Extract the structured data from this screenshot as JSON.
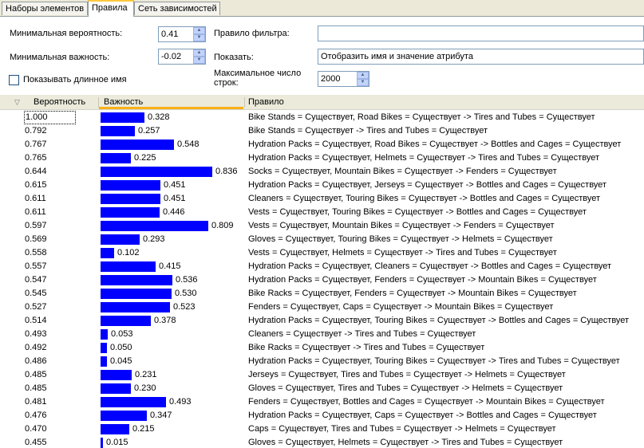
{
  "tabs": [
    {
      "label": "Наборы элементов",
      "active": false
    },
    {
      "label": "Правила",
      "active": true
    },
    {
      "label": "Сеть зависимостей",
      "active": false
    }
  ],
  "filters": {
    "min_probability_label": "Минимальная вероятность:",
    "min_probability_value": "0.41",
    "min_importance_label": "Минимальная важность:",
    "min_importance_value": "-0.02",
    "long_name_label": "Показывать длинное имя",
    "long_name_checked": false,
    "filter_rule_label": "Правило фильтра:",
    "filter_rule_value": "",
    "show_label": "Показать:",
    "show_value": "Отобразить имя и значение атрибута",
    "max_rows_label": "Максимальное число строк:",
    "max_rows_value": "2000"
  },
  "grid": {
    "columns": [
      "Вероятность",
      "Важность",
      "Правило"
    ],
    "accent_color": "#0000ff",
    "rows": [
      {
        "probability": "1.000",
        "importance": 0.328,
        "importance_label": "0.328",
        "rule": "Bike Stands = Существует, Road Bikes = Существует -> Tires and Tubes = Существует"
      },
      {
        "probability": "0.792",
        "importance": 0.257,
        "importance_label": "0.257",
        "rule": "Bike Stands = Существует -> Tires and Tubes = Существует"
      },
      {
        "probability": "0.767",
        "importance": 0.548,
        "importance_label": "0.548",
        "rule": "Hydration Packs = Существует, Road Bikes = Существует -> Bottles and Cages = Существует"
      },
      {
        "probability": "0.765",
        "importance": 0.225,
        "importance_label": "0.225",
        "rule": "Hydration Packs = Существует, Helmets = Существует -> Tires and Tubes = Существует"
      },
      {
        "probability": "0.644",
        "importance": 0.836,
        "importance_label": "0.836",
        "rule": "Socks = Существует, Mountain Bikes = Существует -> Fenders = Существует"
      },
      {
        "probability": "0.615",
        "importance": 0.451,
        "importance_label": "0.451",
        "rule": "Hydration Packs = Существует, Jerseys = Существует -> Bottles and Cages = Существует"
      },
      {
        "probability": "0.611",
        "importance": 0.451,
        "importance_label": "0.451",
        "rule": "Cleaners = Существует, Touring Bikes = Существует -> Bottles and Cages = Существует"
      },
      {
        "probability": "0.611",
        "importance": 0.446,
        "importance_label": "0.446",
        "rule": "Vests = Существует, Touring Bikes = Существует -> Bottles and Cages = Существует"
      },
      {
        "probability": "0.597",
        "importance": 0.809,
        "importance_label": "0.809",
        "rule": "Vests = Существует, Mountain Bikes = Существует -> Fenders = Существует"
      },
      {
        "probability": "0.569",
        "importance": 0.293,
        "importance_label": "0.293",
        "rule": "Gloves = Существует, Touring Bikes = Существует -> Helmets = Существует"
      },
      {
        "probability": "0.558",
        "importance": 0.102,
        "importance_label": "0.102",
        "rule": "Vests = Существует, Helmets = Существует -> Tires and Tubes = Существует"
      },
      {
        "probability": "0.557",
        "importance": 0.415,
        "importance_label": "0.415",
        "rule": "Hydration Packs = Существует, Cleaners = Существует -> Bottles and Cages = Существует"
      },
      {
        "probability": "0.547",
        "importance": 0.536,
        "importance_label": "0.536",
        "rule": "Hydration Packs = Существует, Fenders = Существует -> Mountain Bikes = Существует"
      },
      {
        "probability": "0.545",
        "importance": 0.53,
        "importance_label": "0.530",
        "rule": "Bike Racks = Существует, Fenders = Существует -> Mountain Bikes = Существует"
      },
      {
        "probability": "0.527",
        "importance": 0.523,
        "importance_label": "0.523",
        "rule": "Fenders = Существует, Caps = Существует -> Mountain Bikes = Существует"
      },
      {
        "probability": "0.514",
        "importance": 0.378,
        "importance_label": "0.378",
        "rule": "Hydration Packs = Существует, Touring Bikes = Существует -> Bottles and Cages = Существует"
      },
      {
        "probability": "0.493",
        "importance": 0.053,
        "importance_label": "0.053",
        "rule": "Cleaners = Существует -> Tires and Tubes = Существует"
      },
      {
        "probability": "0.492",
        "importance": 0.05,
        "importance_label": "0.050",
        "rule": "Bike Racks = Существует -> Tires and Tubes = Существует"
      },
      {
        "probability": "0.486",
        "importance": 0.045,
        "importance_label": "0.045",
        "rule": "Hydration Packs = Существует, Touring Bikes = Существует -> Tires and Tubes = Существует"
      },
      {
        "probability": "0.485",
        "importance": 0.231,
        "importance_label": "0.231",
        "rule": "Jerseys = Существует, Tires and Tubes = Существует -> Helmets = Существует"
      },
      {
        "probability": "0.485",
        "importance": 0.23,
        "importance_label": "0.230",
        "rule": "Gloves = Существует, Tires and Tubes = Существует -> Helmets = Существует"
      },
      {
        "probability": "0.481",
        "importance": 0.493,
        "importance_label": "0.493",
        "rule": "Fenders = Существует, Bottles and Cages = Существует -> Mountain Bikes = Существует"
      },
      {
        "probability": "0.476",
        "importance": 0.347,
        "importance_label": "0.347",
        "rule": "Hydration Packs = Существует, Caps = Существует -> Bottles and Cages = Существует"
      },
      {
        "probability": "0.470",
        "importance": 0.215,
        "importance_label": "0.215",
        "rule": "Caps = Существует, Tires and Tubes = Существует -> Helmets = Существует"
      },
      {
        "probability": "0.455",
        "importance": 0.015,
        "importance_label": "0.015",
        "rule": "Gloves = Существует, Helmets = Существует -> Tires and Tubes = Существует"
      }
    ]
  }
}
